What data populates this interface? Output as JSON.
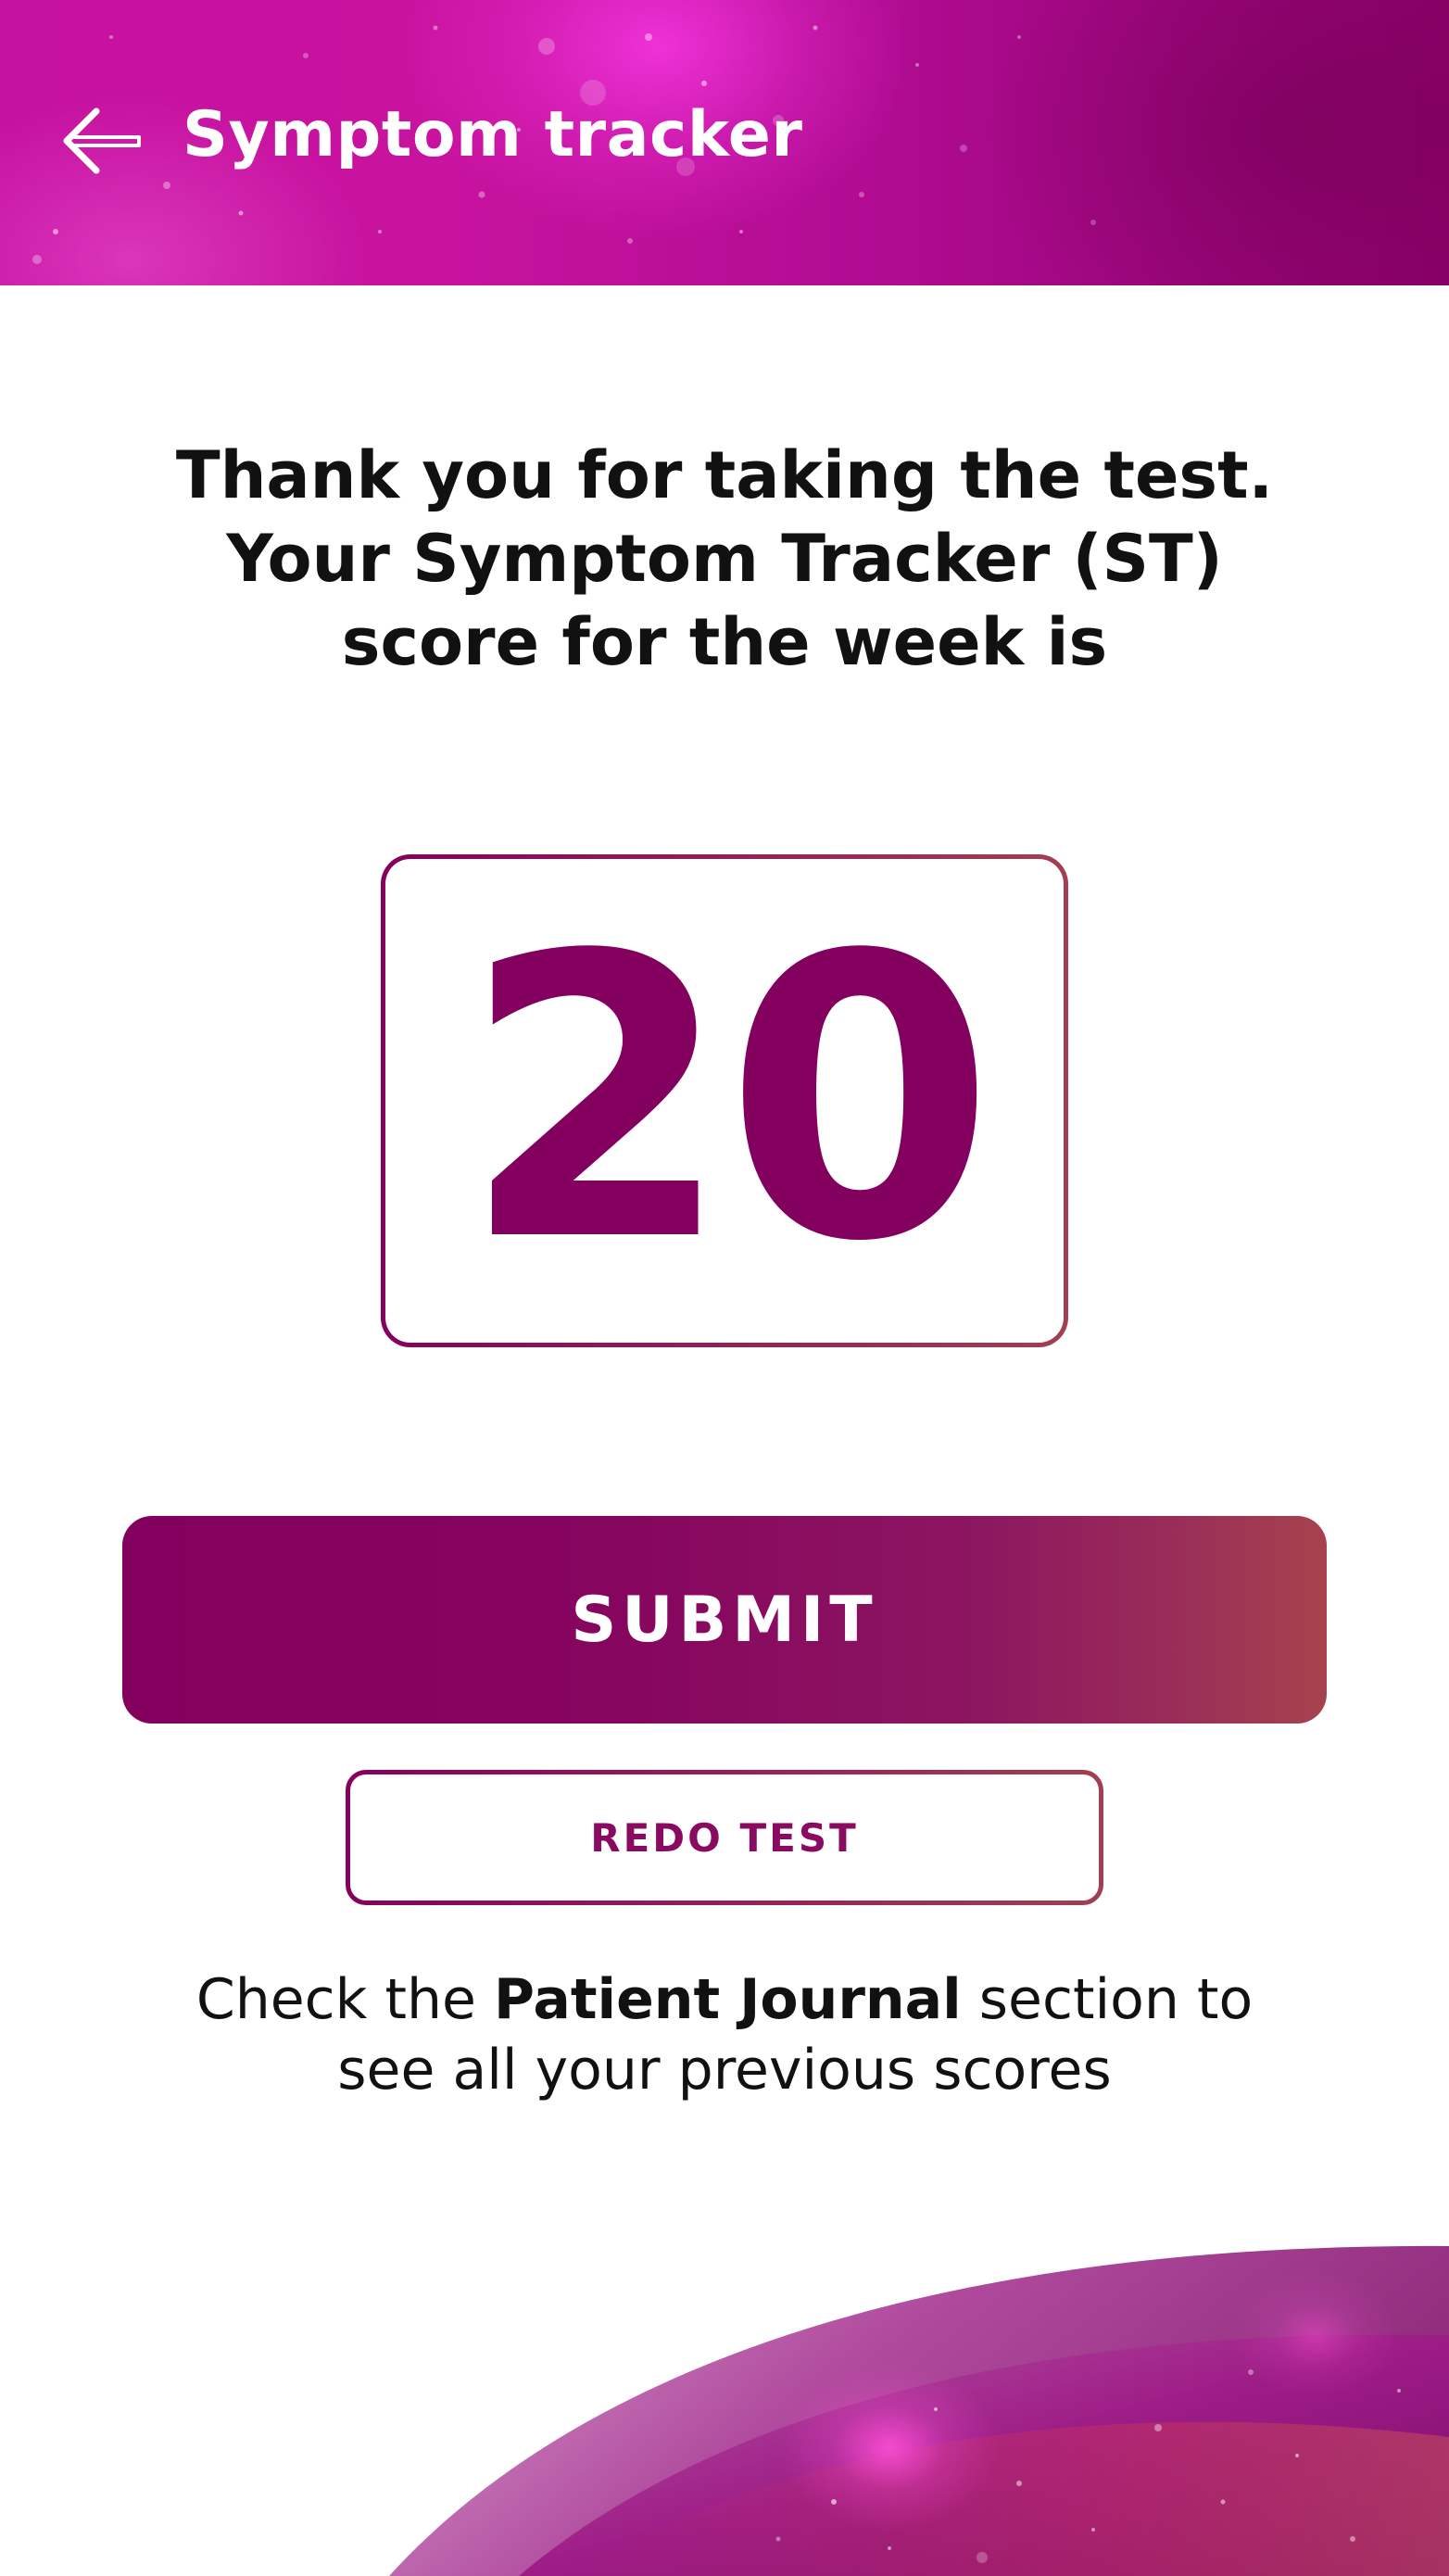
{
  "header": {
    "title": "Symptom tracker",
    "back_icon": "arrow-left-icon"
  },
  "intro": {
    "line1": "Thank you for taking the test.",
    "line2": "Your Symptom Tracker (ST)",
    "line3": "score for the week is"
  },
  "score": {
    "value": "20"
  },
  "actions": {
    "submit_label": "SUBMIT",
    "redo_label": "REDO TEST"
  },
  "info": {
    "prefix": "Check the ",
    "emphasis": "Patient Journal",
    "suffix": " section to",
    "line2": "see all your previous scores"
  },
  "colors": {
    "brand_primary": "#84005f",
    "header_gradient_start": "#c5119f",
    "header_gradient_end": "#8a0068",
    "button_gradient_end": "#a6434e",
    "text": "#111111",
    "background": "#ffffff"
  }
}
